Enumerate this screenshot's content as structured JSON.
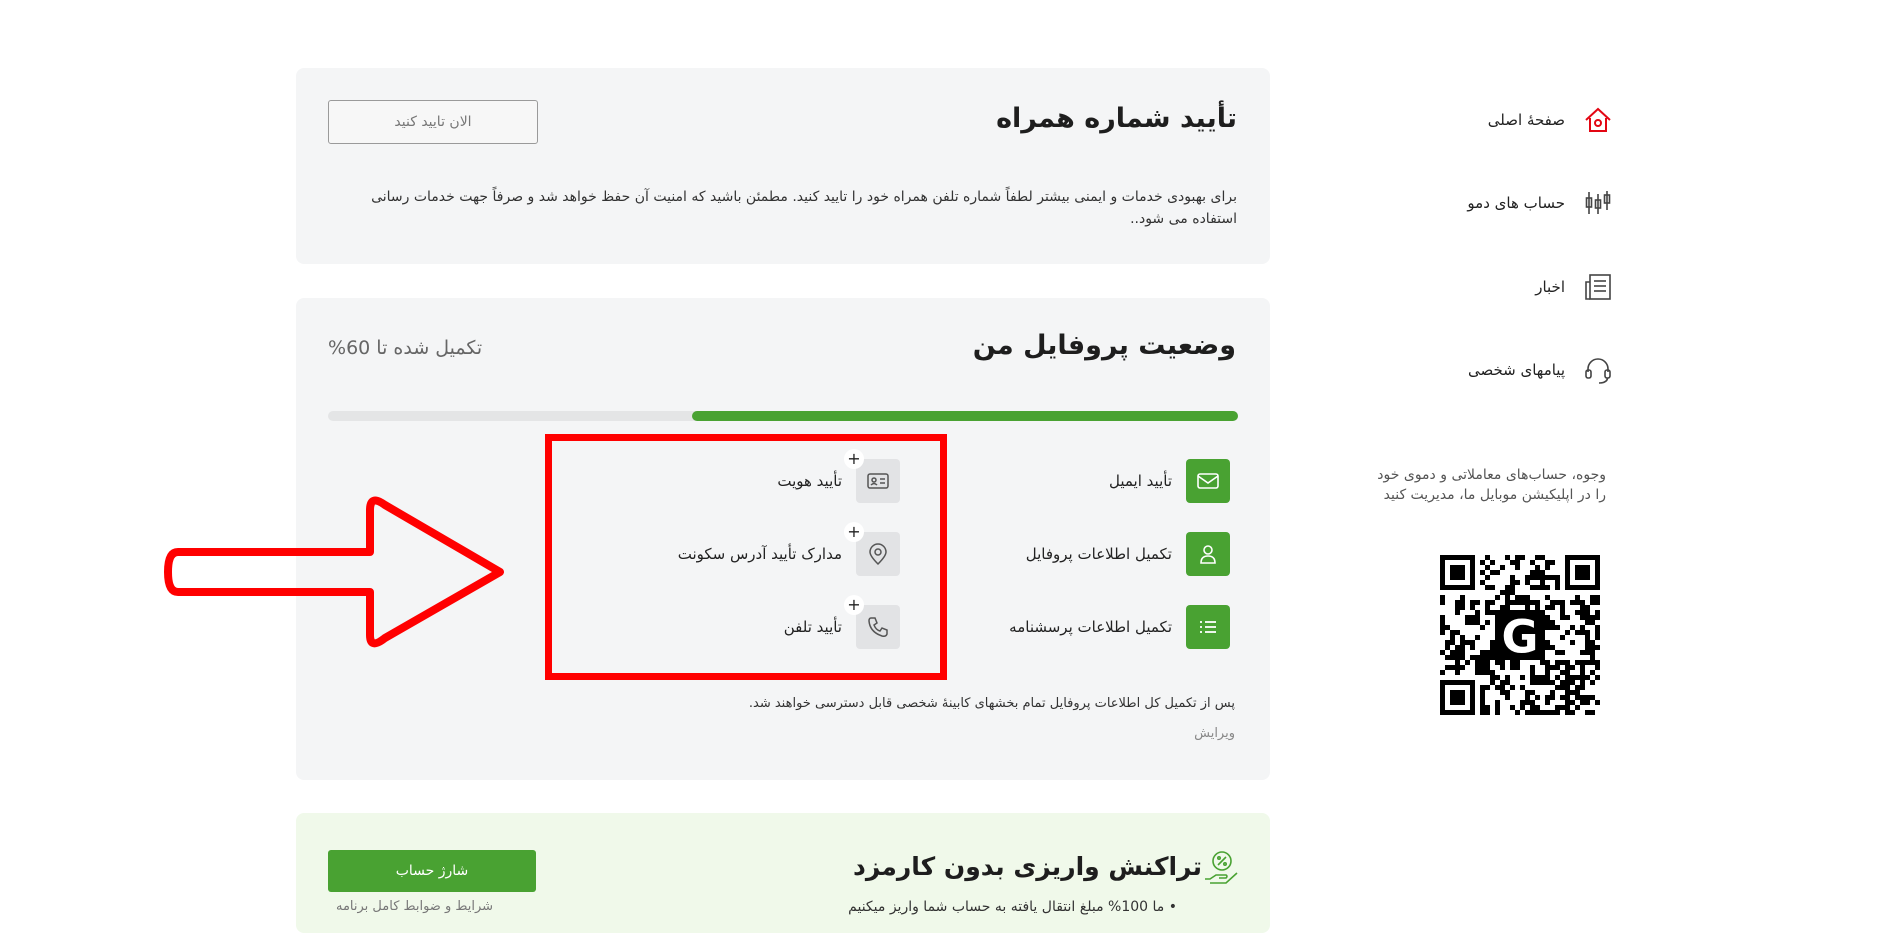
{
  "sidebar": {
    "items": [
      {
        "label": "صفحهٔ اصلی",
        "icon": "home-icon"
      },
      {
        "label": "حساب های دمو",
        "icon": "candlestick-icon"
      },
      {
        "label": "اخبار",
        "icon": "newspaper-icon"
      },
      {
        "label": "پیامهای شخصی",
        "icon": "headset-icon"
      }
    ],
    "app_note": "وجوه، حساب‌های معاملاتی و دموی خود را در اپلیکیشن موبایل ما، مدیریت کنید"
  },
  "phone_verify": {
    "title": "تأیید شماره همراه",
    "button": "الان تایید کنید",
    "description": "برای بهبودی خدمات و ایمنی بیشتر لطفاً شماره تلفن همراه خود را تایید کنید. مطمئن باشید که امنیت آن حفظ خواهد شد و صرفاً جهت خدمات رسانی استفاده می شود.."
  },
  "profile": {
    "title": "وضعیت پروفایل من",
    "completion_text": "تکمیل شده تا 60%",
    "progress": 0.6,
    "completed_steps": [
      {
        "label": "تأیید ایمیل",
        "icon": "envelope-icon"
      },
      {
        "label": "تکمیل اطلاعات پروفایل",
        "icon": "user-icon"
      },
      {
        "label": "تکمیل اطلاعات پرسشنامه",
        "icon": "list-icon"
      }
    ],
    "pending_steps": [
      {
        "label": "تأیید هویت",
        "icon": "id-card-icon",
        "badge": "+"
      },
      {
        "label": "مدارک تأیید آدرس سکونت",
        "icon": "location-pin-icon",
        "badge": "+"
      },
      {
        "label": "تأیید تلفن",
        "icon": "phone-icon",
        "badge": "+"
      }
    ],
    "footer_note": "پس از تکمیل کل اطلاعات پروفایل تمام بخشهای کابینهٔ شخصی قابل دسترسی خواهند شد.",
    "edit_link": "ویرایش"
  },
  "promo": {
    "title": "تراکنش واریزی بدون کارمزد",
    "button": "شارژ حساب",
    "bullet": "ما 100% مبلغ انتقال یافته به حساب شما واریز میکنیم",
    "terms_link": "شرایط و ضوابط کامل برنامه"
  },
  "colors": {
    "accent": "#49a232",
    "brand_red": "#e30613",
    "annotation_red": "#ff0000"
  }
}
